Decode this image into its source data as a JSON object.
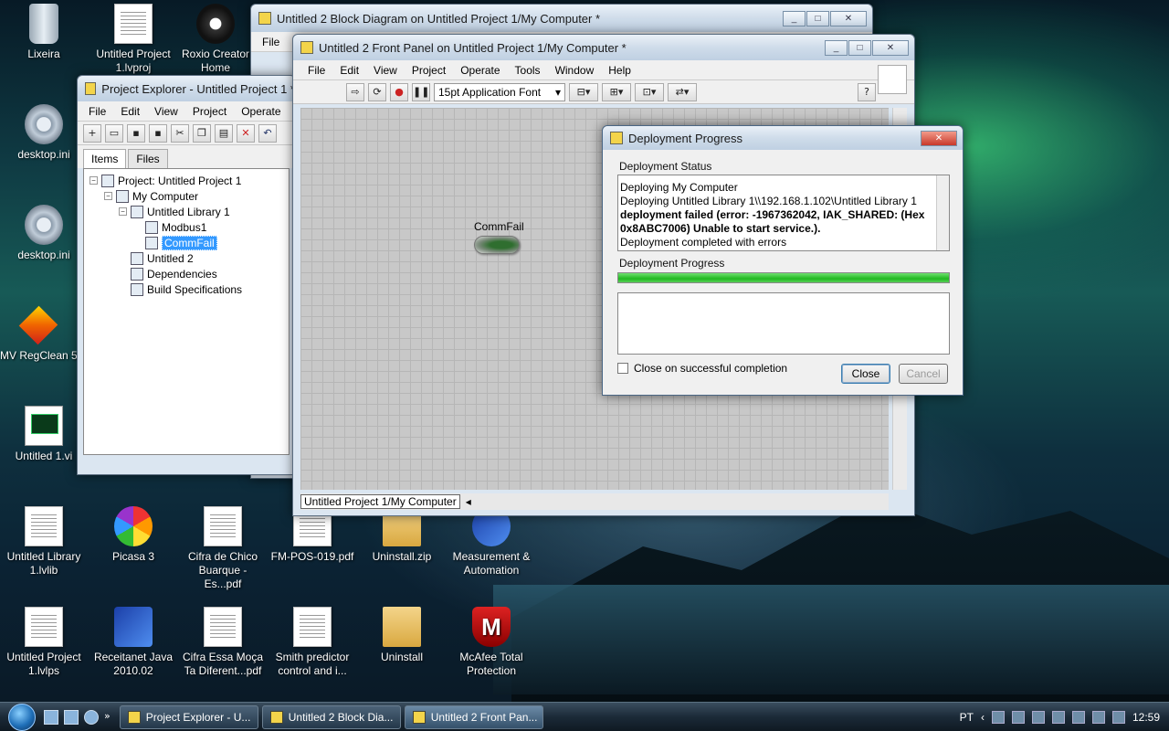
{
  "desktop": {
    "icons": [
      {
        "label": "Lixeira",
        "icon": "recycle-bin-icon"
      },
      {
        "label": "Untitled Project 1.lvproj",
        "icon": "labview-project-icon"
      },
      {
        "label": "Roxio Creator Home",
        "icon": "roxio-icon"
      },
      {
        "label": "desktop.ini",
        "icon": "settings-file-icon"
      },
      {
        "label": "desktop.ini",
        "icon": "settings-file-icon"
      },
      {
        "label": "MV RegClean 5",
        "icon": "regclean-icon"
      },
      {
        "label": "Untitled 1.vi",
        "icon": "labview-vi-icon"
      },
      {
        "label": "Untitled Library 1.lvlib",
        "icon": "labview-library-icon"
      },
      {
        "label": "Picasa 3",
        "icon": "picasa-icon"
      },
      {
        "label": "Cifra de Chico Buarque - Es...pdf",
        "icon": "pdf-icon"
      },
      {
        "label": "FM-POS-019.pdf",
        "icon": "pdf-icon"
      },
      {
        "label": "Uninstall.zip",
        "icon": "zip-folder-icon"
      },
      {
        "label": "Measurement & Automation",
        "icon": "measurement-automation-icon"
      },
      {
        "label": "Untitled Project 1.lvlps",
        "icon": "file-icon"
      },
      {
        "label": "Receitanet Java 2010.02",
        "icon": "receitanet-icon"
      },
      {
        "label": "Cifra Essa Moça Ta Diferent...pdf",
        "icon": "pdf-icon"
      },
      {
        "label": "Smith predictor control and i...",
        "icon": "document-icon"
      },
      {
        "label": "Uninstall",
        "icon": "folder-icon"
      },
      {
        "label": "McAfee Total Protection",
        "icon": "mcafee-icon"
      }
    ]
  },
  "block_diagram": {
    "title": "Untitled 2 Block Diagram on Untitled Project 1/My Computer *",
    "menu_first": "File"
  },
  "project_explorer": {
    "title": "Project Explorer - Untitled Project 1 *",
    "menu": [
      "File",
      "Edit",
      "View",
      "Project",
      "Operate",
      "T"
    ],
    "tabs": [
      "Items",
      "Files"
    ],
    "tree": [
      {
        "label": "Project: Untitled Project 1",
        "level": 0
      },
      {
        "label": "My Computer",
        "level": 1
      },
      {
        "label": "Untitled Library 1",
        "level": 2
      },
      {
        "label": "Modbus1",
        "level": 3
      },
      {
        "label": "CommFail",
        "level": 3
      },
      {
        "label": "Untitled 2",
        "level": 2
      },
      {
        "label": "Dependencies",
        "level": 2
      },
      {
        "label": "Build Specifications",
        "level": 2
      }
    ]
  },
  "front_panel": {
    "title": "Untitled 2 Front Panel on Untitled Project 1/My Computer *",
    "menu": [
      "File",
      "Edit",
      "View",
      "Project",
      "Operate",
      "Tools",
      "Window",
      "Help"
    ],
    "font_combo": "15pt Application Font",
    "indicator_label": "CommFail",
    "status_location": "Untitled Project 1/My Computer"
  },
  "dialog": {
    "title": "Deployment Progress",
    "status_label": "Deployment Status",
    "status_lines": {
      "line1": "Deploying My Computer",
      "line2": "Deploying Untitled Library 1\\\\192.168.1.102\\Untitled Library 1",
      "line3": "deployment failed (error: -1967362042, IAK_SHARED:  (Hex",
      "line4": "0x8ABC7006) Unable to start service.).",
      "line5": "Deployment completed with errors"
    },
    "progress_label": "Deployment Progress",
    "progress": 1.0,
    "checkbox_label": "Close on successful completion",
    "close_button": "Close",
    "cancel_button": "Cancel"
  },
  "taskbar": {
    "tasks": [
      "Project Explorer - U...",
      "Untitled 2 Block Dia...",
      "Untitled 2 Front Pan..."
    ],
    "language": "PT",
    "clock": "12:59"
  }
}
